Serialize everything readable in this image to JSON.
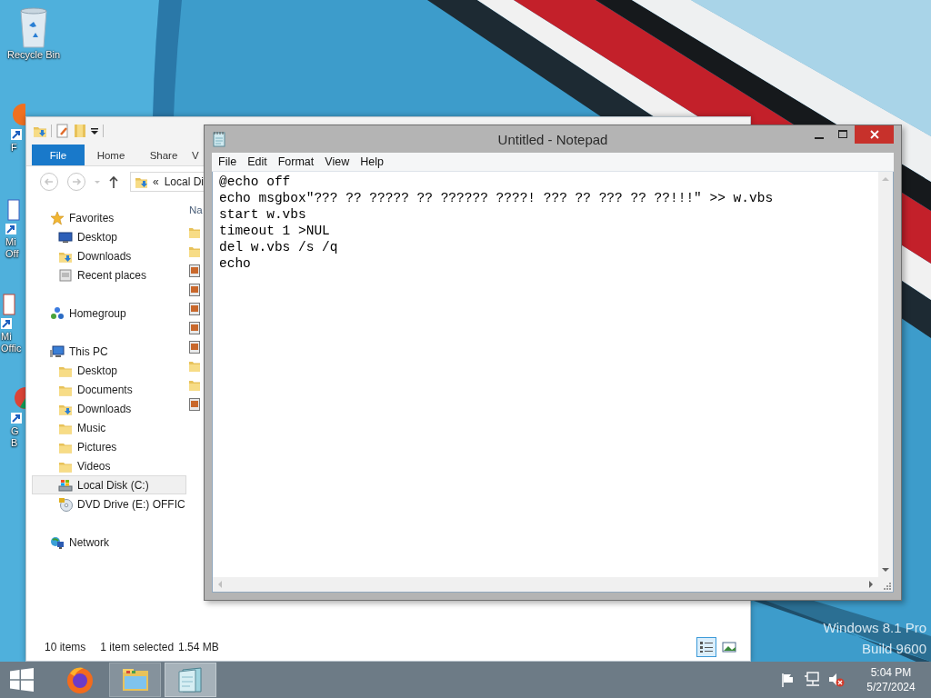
{
  "desktop": {
    "icons": [
      {
        "label": "Recycle Bin"
      },
      {
        "label": "F"
      },
      {
        "label": "Mi Off"
      },
      {
        "label": "Mi Offic"
      },
      {
        "label": "G B"
      }
    ],
    "watermark": [
      "Windows 8.1 Pro",
      "Build 9600"
    ]
  },
  "explorer": {
    "ribbon_tabs": [
      {
        "kind": "menu",
        "label": "File",
        "selected": false
      },
      {
        "kind": "tab",
        "label": "Home",
        "selected": false
      },
      {
        "kind": "tab",
        "label": "Share",
        "selected": false
      },
      {
        "kind": "tab",
        "label": "V",
        "selected": false
      }
    ],
    "address": {
      "chevron": "«",
      "text": "Local Di"
    },
    "column_header": "Na",
    "navigation": [
      {
        "kind": "favorites",
        "label": "Favorites",
        "selected": false,
        "children": [
          {
            "kind": "desktop",
            "label": "Desktop",
            "selected": false
          },
          {
            "kind": "downloads",
            "label": "Downloads",
            "selected": false
          },
          {
            "kind": "recent",
            "label": "Recent places",
            "selected": false
          }
        ]
      },
      {
        "kind": "homegroup",
        "label": "Homegroup",
        "selected": false
      },
      {
        "kind": "pc",
        "label": "This PC",
        "selected": false,
        "children": [
          {
            "kind": "folder",
            "label": "Desktop",
            "selected": false
          },
          {
            "kind": "folder",
            "label": "Documents",
            "selected": false
          },
          {
            "kind": "downloads",
            "label": "Downloads",
            "selected": false
          },
          {
            "kind": "folder",
            "label": "Music",
            "selected": false
          },
          {
            "kind": "folder",
            "label": "Pictures",
            "selected": false
          },
          {
            "kind": "folder",
            "label": "Videos",
            "selected": false
          },
          {
            "kind": "drive",
            "label": "Local Disk (C:)",
            "selected": true
          },
          {
            "kind": "dvd",
            "label": "DVD Drive (E:) OFFIC",
            "selected": false
          }
        ]
      },
      {
        "kind": "network",
        "label": "Network",
        "selected": false
      }
    ],
    "files": [
      {
        "kind": "folder"
      },
      {
        "kind": "folder"
      },
      {
        "kind": "app"
      },
      {
        "kind": "app"
      },
      {
        "kind": "app"
      },
      {
        "kind": "app"
      },
      {
        "kind": "app"
      },
      {
        "kind": "folder"
      },
      {
        "kind": "folder"
      },
      {
        "kind": "app"
      }
    ],
    "status_bar": {
      "count": "10 items",
      "selection": "1 item selected",
      "size": "1.54 MB"
    },
    "view_buttons": [
      {
        "kind": "details",
        "selected": true
      },
      {
        "kind": "icons",
        "selected": false
      }
    ]
  },
  "notepad": {
    "title": "Untitled - Notepad",
    "menu": [
      "File",
      "Edit",
      "Format",
      "View",
      "Help"
    ],
    "lines": [
      "@echo off",
      "echo msgbox\"??? ?? ????? ?? ?????? ????! ??? ?? ??? ?? ??!!!\" >> w.vbs",
      "start w.vbs",
      "timeout 1 >NUL",
      "del w.vbs /s /q",
      "echo"
    ]
  },
  "taskbar": {
    "apps": [
      {
        "kind": "firefox",
        "running": false,
        "selected": false
      },
      {
        "kind": "explorer",
        "running": true,
        "selected": false
      },
      {
        "kind": "notepad",
        "running": true,
        "selected": true
      }
    ],
    "time": "5:04 PM",
    "date": "5/27/2024"
  }
}
